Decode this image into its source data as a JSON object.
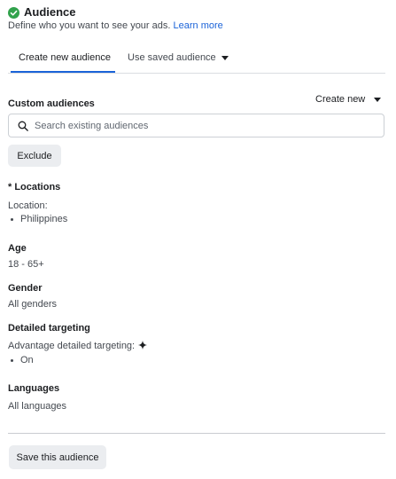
{
  "header": {
    "title": "Audience",
    "subtitle": "Define who you want to see your ads.",
    "learn_more": "Learn more"
  },
  "tabs": [
    {
      "label": "Create new audience",
      "active": true
    },
    {
      "label": "Use saved audience",
      "active": false
    }
  ],
  "custom_audiences": {
    "label": "Custom audiences",
    "create_new": "Create new",
    "search_placeholder": "Search existing audiences",
    "exclude_label": "Exclude"
  },
  "locations": {
    "label": "* Locations",
    "sub_label": "Location:",
    "items": [
      "Philippines"
    ]
  },
  "age": {
    "label": "Age",
    "value": "18 - 65+"
  },
  "gender": {
    "label": "Gender",
    "value": "All genders"
  },
  "detailed_targeting": {
    "label": "Detailed targeting",
    "advantage_label": "Advantage detailed targeting:",
    "items": [
      "On"
    ]
  },
  "languages": {
    "label": "Languages",
    "value": "All languages"
  },
  "save_label": "Save this audience",
  "colors": {
    "accent": "#1b63d8",
    "success": "#31a24c"
  },
  "icons": [
    "check-circle-icon",
    "chevron-down-icon",
    "search-icon",
    "sparkle-icon"
  ]
}
